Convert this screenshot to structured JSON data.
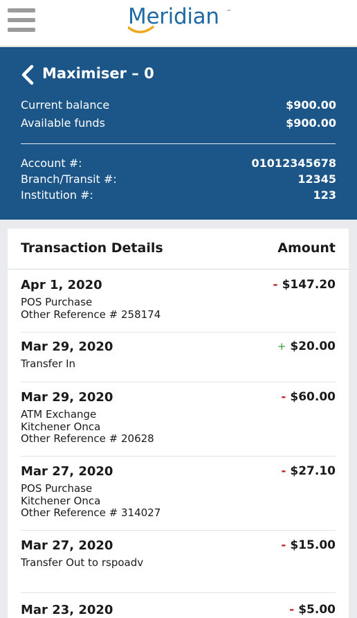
{
  "header": {
    "logo_text": "Meridian",
    "logo_tm": "™",
    "brand_color": "#1f6aa5",
    "swoosh_color": "#f0a81c"
  },
  "account": {
    "title": "Maximiser – 0",
    "current_balance_label": "Current balance",
    "current_balance": "$900.00",
    "available_funds_label": "Available funds",
    "available_funds": "$900.00",
    "account_number_label": "Account #:",
    "account_number": "01012345678",
    "branch_label": "Branch/Transit #:",
    "branch": "12345",
    "institution_label": "Institution #:",
    "institution": "123",
    "panel_color": "#1c5689"
  },
  "transactions": {
    "header_left": "Transaction Details",
    "header_right": "Amount",
    "items": [
      {
        "date": "Apr 1, 2020",
        "sign": "-",
        "amount": "$147.20",
        "lines": [
          "POS Purchase",
          "Other Reference # 258174"
        ]
      },
      {
        "date": "Mar 29, 2020",
        "sign": "+",
        "amount": "$20.00",
        "lines": [
          "Transfer In"
        ]
      },
      {
        "date": "Mar 29, 2020",
        "sign": "-",
        "amount": "$60.00",
        "lines": [
          "ATM Exchange",
          "Kitchener Onca",
          "Other Reference # 20628"
        ]
      },
      {
        "date": "Mar 27, 2020",
        "sign": "-",
        "amount": "$27.10",
        "lines": [
          "POS Purchase",
          "Kitchener Onca",
          "Other Reference # 314027"
        ]
      },
      {
        "date": "Mar 27, 2020",
        "sign": "-",
        "amount": "$15.00",
        "lines": [
          "Transfer Out to rspoadv"
        ]
      },
      {
        "date": "Mar 23, 2020",
        "sign": "-",
        "amount": "$5.00",
        "lines": []
      }
    ]
  }
}
